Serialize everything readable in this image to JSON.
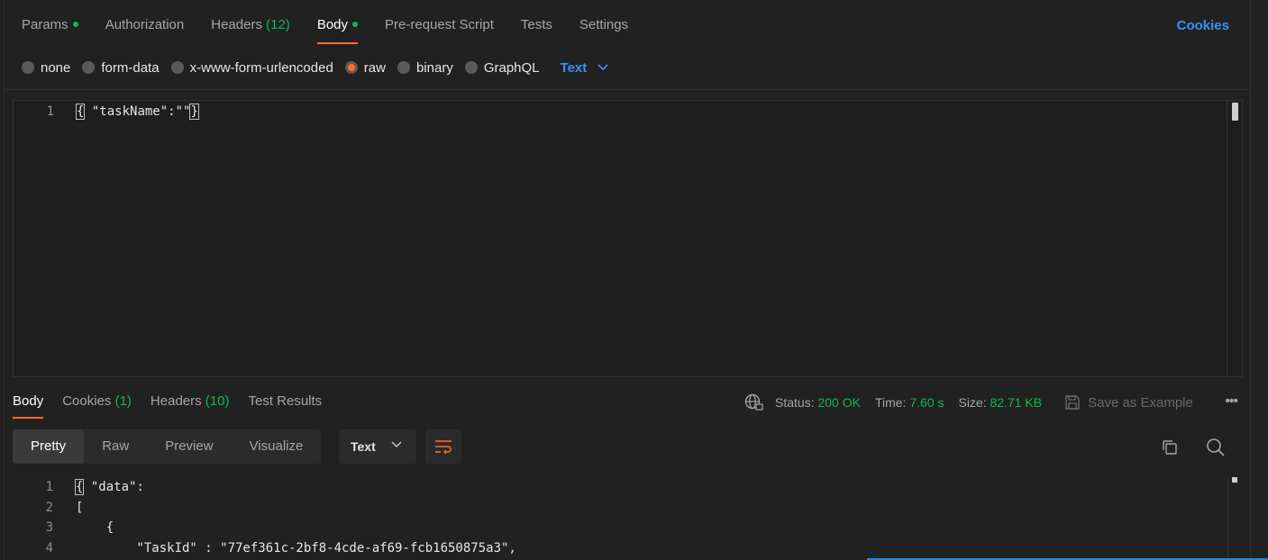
{
  "request_tabs": [
    {
      "label": "Params",
      "dot": true
    },
    {
      "label": "Authorization"
    },
    {
      "label": "Headers",
      "count": "(12)"
    },
    {
      "label": "Body",
      "dot": true,
      "active": true
    },
    {
      "label": "Pre-request Script"
    },
    {
      "label": "Tests"
    },
    {
      "label": "Settings"
    }
  ],
  "cookies_link": "Cookies",
  "body_types": {
    "options": [
      "none",
      "form-data",
      "x-www-form-urlencoded",
      "raw",
      "binary",
      "GraphQL"
    ],
    "selected": "raw",
    "format": "Text"
  },
  "request_body": {
    "line_number": "1",
    "open": "{",
    "content": " \"taskName\":\"\"",
    "close": "}"
  },
  "response_tabs": [
    {
      "label": "Body",
      "active": true
    },
    {
      "label": "Cookies",
      "count": "(1)"
    },
    {
      "label": "Headers",
      "count": "(10)"
    },
    {
      "label": "Test Results"
    }
  ],
  "response_meta": {
    "status_label": "Status:",
    "status_value": "200 OK",
    "time_label": "Time:",
    "time_value": "7.60 s",
    "size_label": "Size:",
    "size_value": "82.71 KB",
    "save_example": "Save as Example"
  },
  "view_modes": [
    "Pretty",
    "Raw",
    "Preview",
    "Visualize"
  ],
  "view_active": "Pretty",
  "response_format": "Text",
  "response_body": {
    "lines": [
      {
        "n": "1",
        "text": " \"data\":"
      },
      {
        "n": "2",
        "text": "["
      },
      {
        "n": "3",
        "text": "    {"
      },
      {
        "n": "4",
        "text": "        \"TaskId\" : \"77ef361c-2bf8-4cde-af69-fcb1650875a3\","
      }
    ],
    "first_open": "{"
  },
  "colors": {
    "accent": "#ff6c37",
    "success": "#0cbb52",
    "link": "#3d8ef8",
    "background": "#212121"
  }
}
